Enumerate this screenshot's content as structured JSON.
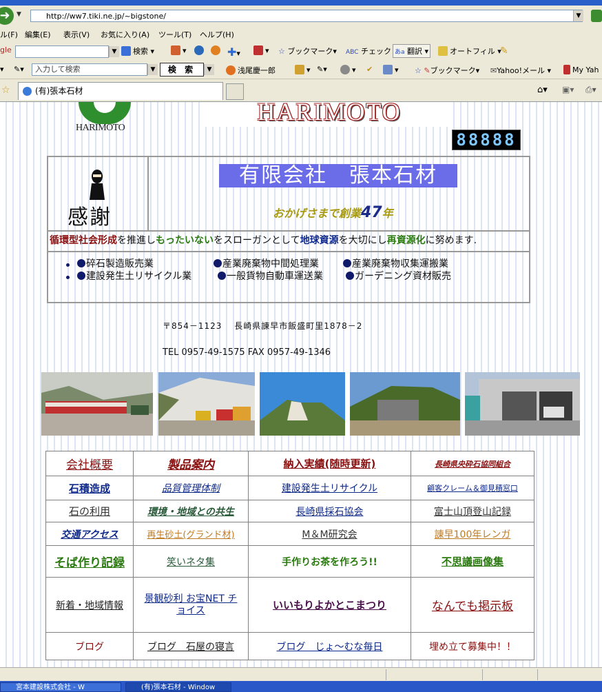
{
  "browser": {
    "url": "http://ww7.tiki.ne.jp/~bigstone/",
    "menu": [
      "ル(F)",
      "編集(E)",
      "表示(V)",
      "お気に入り(A)",
      "ツール(T)",
      "ヘルプ(H)"
    ],
    "toolbar1": {
      "google_label": "gle",
      "search_label": "検索",
      "bookmark_label": "ブックマーク",
      "check_label": "チェック",
      "translate_label": "翻訳",
      "autofill_label": "オートフィル"
    },
    "toolbar2": {
      "search_placeholder": "入力して検索",
      "search_button": "検 索",
      "person_label": "浅尾慶一郎",
      "bookmark_label": "ブックマーク",
      "yahoo_mail_label": "Yahoo!メール",
      "my_yahoo_label": "My Yah"
    },
    "tab_title": "(有)張本石材",
    "taskbar": [
      "宮本建設株式会社 - W",
      "(有)張本石材 - Window"
    ]
  },
  "page": {
    "logo_text": "HARIMOTO",
    "banner_text": "HARIMOTO",
    "counter": "88888",
    "kansha": "感謝",
    "company_name": "有限会社　張本石材",
    "years_prefix": "おかげさまで創業",
    "years_number": "47",
    "years_suffix": "年",
    "slogan": {
      "p1": "循環型社会形成",
      "p2": "を推進し",
      "p3": "もったいない",
      "p4": "をスローガンとして",
      "p5": "地球資源",
      "p6": "を大切にし",
      "p7": "再資源化",
      "p8": "に努めます."
    },
    "businesses": [
      "碎石製造販売業",
      "産業廃棄物中間処理業",
      "産業廃棄物収集運搬業",
      "建設発生土リサイクル業",
      "一般貨物自動車運送業",
      "ガーデニング資材販売"
    ],
    "address": "〒854－1123　 長崎県諌早市飯盛町里1878－2",
    "tel": "TEL 0957-49-1575 FAX 0957-49-1346",
    "links": [
      [
        "会社概要",
        "製品案内",
        "納入実績(随時更新)",
        "長崎県央砕石協同組合"
      ],
      [
        "石積造成",
        "品質管理体制",
        "建設発生土リサイクル",
        "顧客クレーム＆御見積窓口"
      ],
      [
        "石の利用",
        "環境・地域との共生",
        "長崎県採石協会",
        "富士山頂登山記録"
      ],
      [
        "交通アクセス",
        "再生砂土(グランド材)",
        "M＆M研究会",
        "諌早100年レンガ"
      ],
      [
        "そば作り記録",
        "笑いネタ集",
        "手作りお茶を作ろう!!",
        "不思議画像集"
      ],
      [
        "新着・地域情報",
        "景観砂利 お宝NET チョイス",
        "いいもりよかとこまつり",
        "なんでも掲示板"
      ],
      [
        "ブログ",
        "ブログ　石屋の寝言",
        "ブログ　じょ～むな毎日",
        "埋め立て募集中！！"
      ]
    ]
  }
}
